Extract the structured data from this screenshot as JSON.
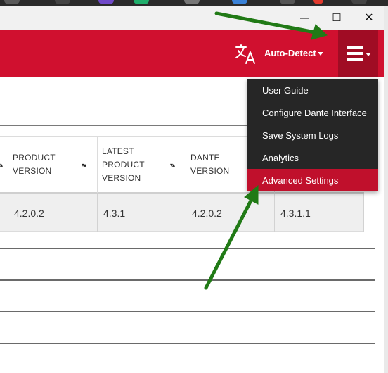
{
  "window": {
    "minimize_glyph": "—",
    "maximize_glyph": "☐",
    "close_glyph": "✕"
  },
  "header": {
    "language_label": "Auto-Detect",
    "translate_icon": "translate-icon",
    "menu_icon": "hamburger-menu-icon",
    "brand_color": "#d0102f"
  },
  "table": {
    "columns": [
      {
        "label_line1": "PRODUCT",
        "label_line2": "VERSION",
        "label_line3": ""
      },
      {
        "label_line1": "LATEST",
        "label_line2": "PRODUCT",
        "label_line3": "VERSION"
      },
      {
        "label_line1": "DANTE",
        "label_line2": "VERSION",
        "label_line3": ""
      }
    ],
    "sort_glyph": "▾▴",
    "row": {
      "product_version": "4.2.0.2",
      "latest_product_version": "4.3.1",
      "dante_version": "4.2.0.2",
      "next_col_value": "4.3.1.1"
    }
  },
  "menu": {
    "items": [
      {
        "label": "User Guide"
      },
      {
        "label": "Configure Dante Interface"
      },
      {
        "label": "Save System Logs"
      },
      {
        "label": "Analytics"
      },
      {
        "label": "Advanced Settings"
      }
    ],
    "highlight_color": "#c0102c"
  },
  "annotation": {
    "arrow_color": "#217a16"
  }
}
